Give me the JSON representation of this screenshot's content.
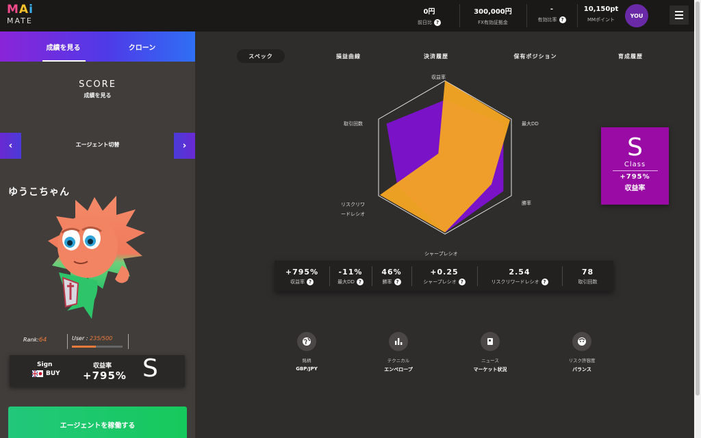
{
  "brand": {
    "line1": "MAi",
    "line2": "MATE"
  },
  "header": {
    "stats": [
      {
        "value": "0円",
        "caption": "前日比"
      },
      {
        "value": "300,000円",
        "caption": "FX有効証拠金"
      },
      {
        "value": "-",
        "caption": "有効比率"
      },
      {
        "value": "10,150pt",
        "caption": "MMポイント"
      }
    ],
    "avatar": "YOU"
  },
  "left": {
    "tabs": [
      "成績を見る",
      "クローン"
    ],
    "score_title": "SCORE",
    "score_sub": "成績を見る",
    "switch_label": "エージェント切替",
    "prev": "‹",
    "next": "›",
    "agent_name": "ゆうこちゃん",
    "rank_label": "Rank:",
    "rank_value": "64",
    "user_label": "User :",
    "user_value": "235/500",
    "user_progress": 0.47,
    "sign_label": "Sign",
    "sign_value": "BUY",
    "ret_label": "収益率",
    "ret_value": "+795%",
    "class": "S",
    "run_button": "エージェントを稼働する"
  },
  "tabs": [
    "スペック",
    "損益曲線",
    "決済履歴",
    "保有ポジション",
    "育成履歴"
  ],
  "active_tab": 0,
  "radar": {
    "axes": [
      "収益率",
      "最大DD",
      "勝率",
      "シャープレシオ",
      "リスクリワードレシオ",
      "取引回数"
    ],
    "axis_label_4_line1": "リスクリワ",
    "axis_label_4_line2": "ードレシオ",
    "series_a": [
      0.75,
      0.88,
      0.88,
      0.98,
      0.72,
      0.88
    ],
    "series_b": [
      1.0,
      0.98,
      0.7,
      0.98,
      0.98,
      0.1
    ],
    "color_a": "#7a12c8",
    "color_b": "#f5a623"
  },
  "class_card": {
    "grade": "S",
    "label": "Class",
    "value": "+795%",
    "metric": "収益率"
  },
  "metrics": [
    {
      "value": "+795%",
      "label": "収益率"
    },
    {
      "value": "-11%",
      "label": "最大DD"
    },
    {
      "value": "46%",
      "label": "勝率"
    },
    {
      "value": "+0.25",
      "label": "シャープレシオ"
    },
    {
      "value": "2.54",
      "label": "リスクリワードレシオ"
    },
    {
      "value": "78",
      "label": "取引回数"
    }
  ],
  "infos": [
    {
      "icon": "globe-icon",
      "label": "銘柄",
      "value": "GBP/JPY"
    },
    {
      "icon": "bar-chart-icon",
      "label": "テクニカル",
      "value": "エンベロープ"
    },
    {
      "icon": "news-icon",
      "label": "ニュース",
      "value": "マーケット状況"
    },
    {
      "icon": "face-icon",
      "label": "リスク許容度",
      "value": "バランス"
    }
  ]
}
